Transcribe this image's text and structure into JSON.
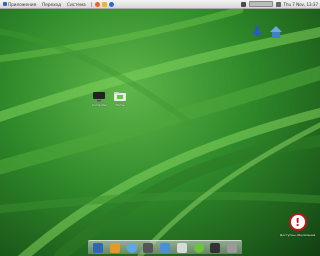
{
  "top_panel": {
    "menus": [
      {
        "label": "Приложения",
        "icon": "foot-icon"
      },
      {
        "label": "Переход",
        "icon": ""
      },
      {
        "label": "Система",
        "icon": ""
      }
    ],
    "launchers": [
      {
        "icon": "firefox-icon",
        "color": "#e8661b"
      },
      {
        "icon": "email-icon",
        "color": "#e1b93c"
      },
      {
        "icon": "help-icon",
        "color": "#2b6cc6"
      }
    ],
    "clock": "Thu 7 Nov, 13:37"
  },
  "desktop_icons": [
    {
      "label": "Computer",
      "icon": "monitor-icon"
    },
    {
      "label": "Home",
      "icon": "home-folder-icon"
    }
  ],
  "top_right_icons": [
    {
      "icon": "download-icon"
    },
    {
      "icon": "home-icon"
    }
  ],
  "dock": [
    {
      "icon": "finder-icon",
      "color": "#2f66b6"
    },
    {
      "icon": "tools-icon",
      "color": "#e39a2a"
    },
    {
      "icon": "globe-icon",
      "color": "#5fa8e8"
    },
    {
      "icon": "media-icon",
      "color": "#555555"
    },
    {
      "icon": "app-icon",
      "color": "#4b8fd4"
    },
    {
      "icon": "calendar-icon",
      "color": "#d9d9d9"
    },
    {
      "icon": "update-icon",
      "color": "#6cc43a"
    },
    {
      "icon": "terminal-icon",
      "color": "#333333"
    },
    {
      "icon": "trash-icon",
      "color": "#9a9a9a"
    }
  ],
  "notification": {
    "label": "Доступны обновления",
    "color": "#c0141b"
  }
}
